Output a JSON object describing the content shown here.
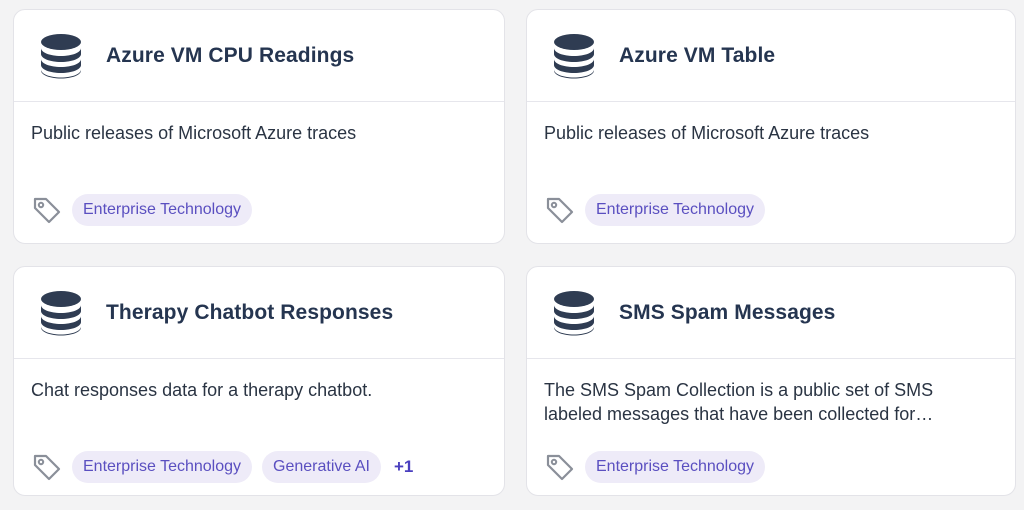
{
  "cards": [
    {
      "title": "Azure VM CPU Readings",
      "description": "Public releases of Microsoft Azure traces",
      "tags": [
        "Enterprise Technology"
      ],
      "more": ""
    },
    {
      "title": "Azure VM Table",
      "description": "Public releases of Microsoft Azure traces",
      "tags": [
        "Enterprise Technology"
      ],
      "more": ""
    },
    {
      "title": "Therapy Chatbot Responses",
      "description": "Chat responses data for a therapy chatbot.",
      "tags": [
        "Enterprise Technology",
        "Generative AI"
      ],
      "more": "+1"
    },
    {
      "title": "SMS Spam Messages",
      "description": "The SMS Spam Collection is a public set of SMS labeled messages that have been collected for…",
      "tags": [
        "Enterprise Technology"
      ],
      "more": ""
    }
  ],
  "colors": {
    "title": "#253550",
    "chip_bg": "#eeebf8",
    "chip_text": "#5a4fc0",
    "icon": "#2f3c52"
  },
  "icons": {
    "dataset": "database-icon",
    "tags": "tag-icon"
  }
}
